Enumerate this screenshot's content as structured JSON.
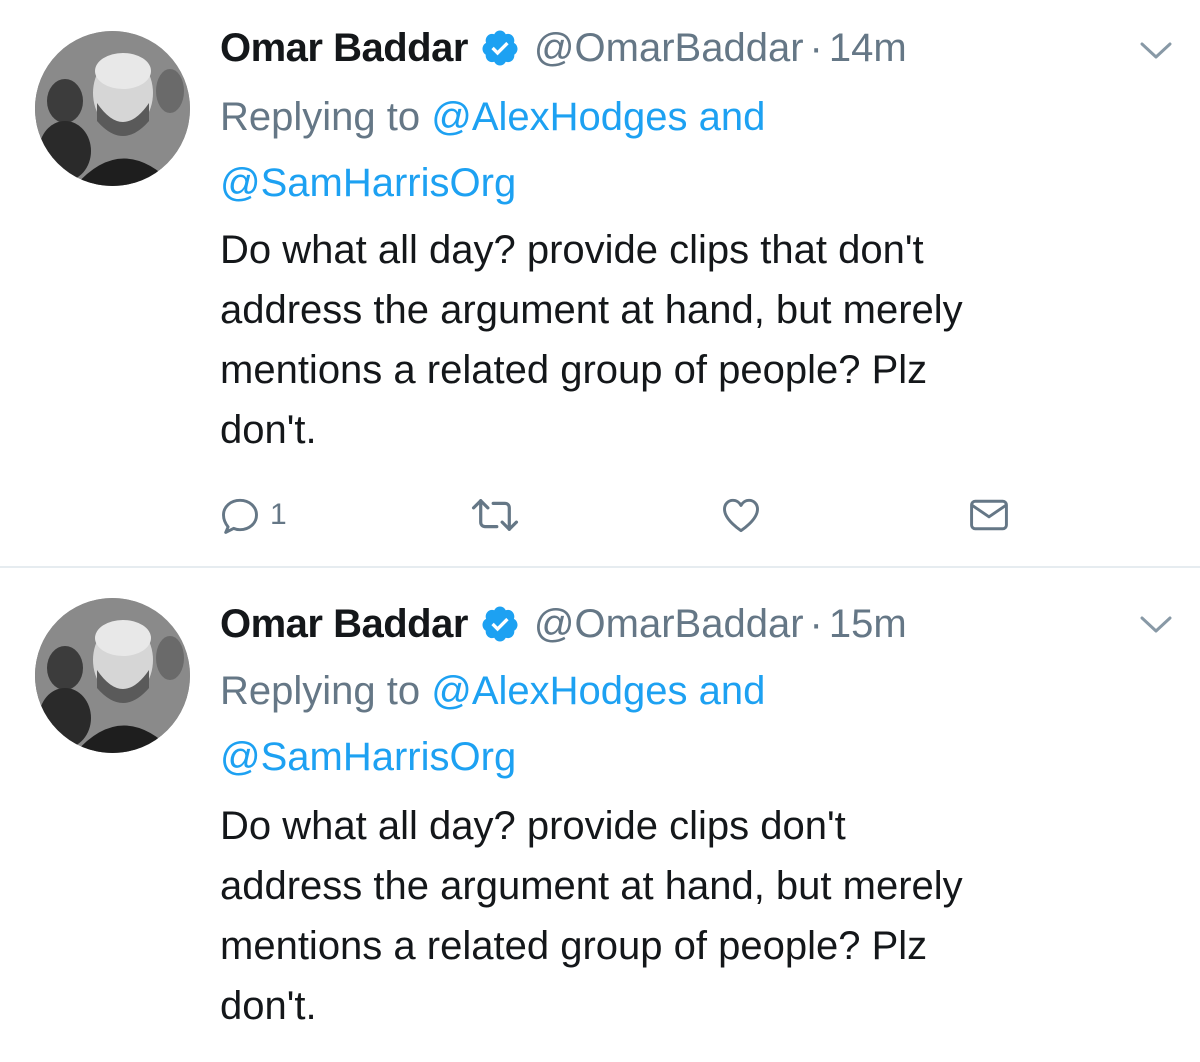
{
  "tweets": [
    {
      "author_name": "Omar Baddar",
      "handle": "@OmarBaddar",
      "separator": "·",
      "time": "14m",
      "replying_prefix": "Replying to",
      "reply_to_1": "@AlexHodges",
      "reply_and": "and",
      "reply_to_2": "@SamHarrisOrg",
      "body_lines": [
        "Do what all day? provide clips that don't",
        "address the argument at hand, but merely",
        "mentions a related group of people? Plz",
        "don't."
      ],
      "reply_count": "1",
      "icons": [
        "reply-icon",
        "retweet-icon",
        "like-icon",
        "direct-message-icon"
      ]
    },
    {
      "author_name": "Omar Baddar",
      "handle": "@OmarBaddar",
      "separator": "·",
      "time": "15m",
      "replying_prefix": "Replying to",
      "reply_to_1": "@AlexHodges",
      "reply_and": "and",
      "reply_to_2": "@SamHarrisOrg",
      "body_lines": [
        "Do what all day? provide clips don't",
        "address the argument at hand, but merely",
        "mentions a related group of people? Plz",
        "don't."
      ]
    }
  ],
  "colors": {
    "text_primary": "#14171a",
    "text_secondary": "#657786",
    "link": "#1da1f2",
    "verified_badge": "#1da1f2",
    "divider": "#e6ecf0"
  }
}
